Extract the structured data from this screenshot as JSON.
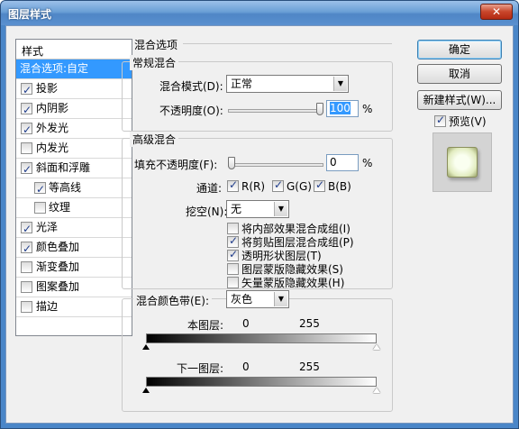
{
  "window": {
    "title": "图层样式",
    "close_glyph": "✕"
  },
  "styles": {
    "header": "样式",
    "items": [
      {
        "label": "混合选项:自定",
        "checkable": false,
        "checked": false,
        "selected": true,
        "sub": false
      },
      {
        "label": "投影",
        "checkable": true,
        "checked": true,
        "selected": false,
        "sub": false
      },
      {
        "label": "内阴影",
        "checkable": true,
        "checked": true,
        "selected": false,
        "sub": false
      },
      {
        "label": "外发光",
        "checkable": true,
        "checked": true,
        "selected": false,
        "sub": false
      },
      {
        "label": "内发光",
        "checkable": true,
        "checked": false,
        "selected": false,
        "sub": false
      },
      {
        "label": "斜面和浮雕",
        "checkable": true,
        "checked": true,
        "selected": false,
        "sub": false
      },
      {
        "label": "等高线",
        "checkable": true,
        "checked": true,
        "selected": false,
        "sub": true
      },
      {
        "label": "纹理",
        "checkable": true,
        "checked": false,
        "selected": false,
        "sub": true
      },
      {
        "label": "光泽",
        "checkable": true,
        "checked": true,
        "selected": false,
        "sub": false
      },
      {
        "label": "颜色叠加",
        "checkable": true,
        "checked": true,
        "selected": false,
        "sub": false
      },
      {
        "label": "渐变叠加",
        "checkable": true,
        "checked": false,
        "selected": false,
        "sub": false
      },
      {
        "label": "图案叠加",
        "checkable": true,
        "checked": false,
        "selected": false,
        "sub": false
      },
      {
        "label": "描边",
        "checkable": true,
        "checked": false,
        "selected": false,
        "sub": false
      }
    ]
  },
  "blending": {
    "title": "混合选项",
    "general": {
      "title": "常规混合",
      "mode_label": "混合模式(D):",
      "mode_value": "正常",
      "opacity_label": "不透明度(O):",
      "opacity_value": "100",
      "opacity_fraction": 1.0,
      "unit": "%"
    },
    "advanced": {
      "title": "高级混合",
      "fill_label": "填充不透明度(F):",
      "fill_value": "0",
      "fill_fraction": 0.0,
      "unit": "%",
      "channels_label": "通道:",
      "channels": [
        {
          "label": "R(R)",
          "checked": true
        },
        {
          "label": "G(G)",
          "checked": true
        },
        {
          "label": "B(B)",
          "checked": true
        }
      ],
      "knockout_label": "挖空(N):",
      "knockout_value": "无",
      "options": [
        {
          "label": "将内部效果混合成组(I)",
          "checked": false
        },
        {
          "label": "将剪贴图层混合成组(P)",
          "checked": true
        },
        {
          "label": "透明形状图层(T)",
          "checked": true
        },
        {
          "label": "图层蒙版隐藏效果(S)",
          "checked": false
        },
        {
          "label": "矢量蒙版隐藏效果(H)",
          "checked": false
        }
      ]
    },
    "blend_if": {
      "label": "混合颜色带(E):",
      "value": "灰色",
      "this_layer_label": "本图层:",
      "this_layer_low": "0",
      "this_layer_high": "255",
      "underlying_label": "下一图层:",
      "underlying_low": "0",
      "underlying_high": "255"
    }
  },
  "buttons": {
    "ok": "确定",
    "cancel": "取消",
    "new_style": "新建样式(W)...",
    "preview_label": "预览(V)",
    "preview_checked": true
  }
}
